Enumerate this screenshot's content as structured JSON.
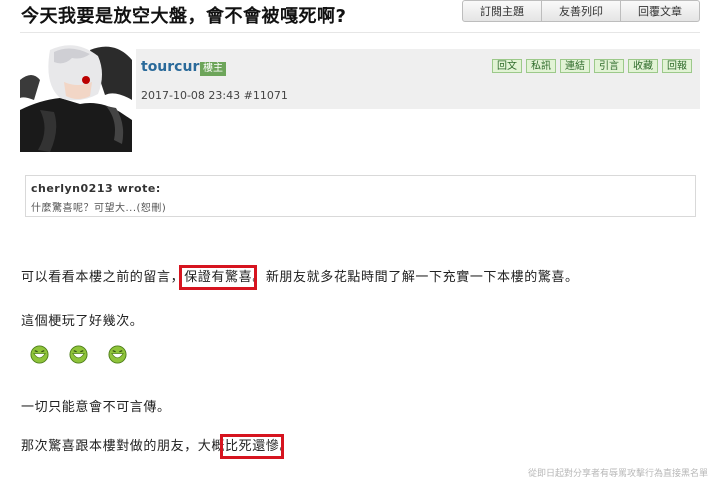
{
  "thread": {
    "title": "今天我要是放空大盤，會不會被嘎死啊?"
  },
  "tabs": [
    "訂閱主題",
    "友善列印",
    "回覆文章"
  ],
  "post": {
    "author": "tourcura",
    "badge": "樓主",
    "date": "2017-10-08 23:43",
    "floor": "#11071",
    "actions": [
      "回文",
      "私訊",
      "連結",
      "引言",
      "收藏",
      "回報"
    ]
  },
  "quote": {
    "author": "cherlyn0213 wrote:",
    "text": "什麼驚喜呢？可望大...(恕刪)"
  },
  "body": {
    "p1_before": "可以看看本樓之前的留言，",
    "p1_highlight": "保證有驚喜",
    "p1_after": "。新朋友就多花點時間了解一下充實一下本樓的驚喜。",
    "p2": "這個梗玩了好幾次。",
    "p3": "一切只能意會不可言傳。",
    "p4_before": "那次驚喜跟本樓對做的朋友，大概",
    "p4_highlight": "比死還慘",
    "p4_after": "。"
  },
  "emotes": [
    "grin-emoticon",
    "grin-emoticon",
    "grin-emoticon"
  ],
  "watermark": "從即日起對分享者有辱罵攻擊行為直接黑名單",
  "colors": {
    "author": "#2a6a9a",
    "badge": "#6da55a",
    "highlight_box": "#d6141f",
    "action_bg": "#e2f3d5"
  }
}
